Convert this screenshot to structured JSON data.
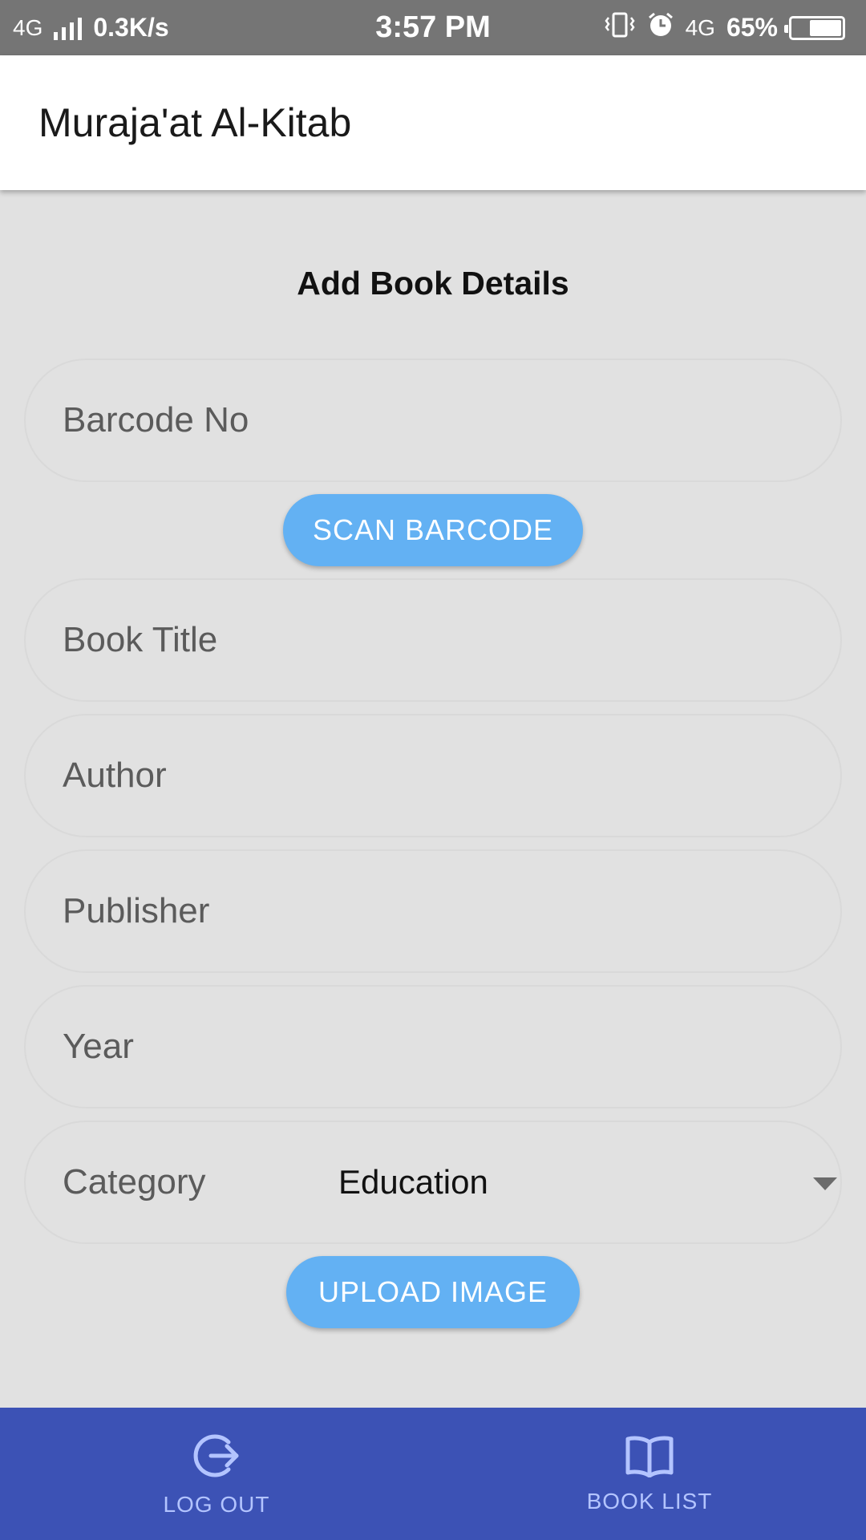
{
  "status_bar": {
    "network_left": "4G",
    "speed": "0.3K/s",
    "time": "3:57 PM",
    "network_right": "4G",
    "battery": "65%",
    "battery_level": 0.65
  },
  "app_bar": {
    "title": "Muraja'at Al-Kitab"
  },
  "form": {
    "heading": "Add Book Details",
    "barcode_placeholder": "Barcode No",
    "scan_button": "SCAN BARCODE",
    "title_placeholder": "Book Title",
    "author_placeholder": "Author",
    "publisher_placeholder": "Publisher",
    "year_placeholder": "Year",
    "category_label": "Category",
    "category_value": "Education",
    "upload_button": "UPLOAD IMAGE"
  },
  "bottom_nav": {
    "logout_label": "LOG OUT",
    "booklist_label": "BOOK LIST"
  },
  "colors": {
    "accent_button": "#63b1f3",
    "bottom_nav": "#3c52b5",
    "nav_text": "#b3c4ff",
    "status_bar": "#757575",
    "background": "#e1e1e1"
  }
}
